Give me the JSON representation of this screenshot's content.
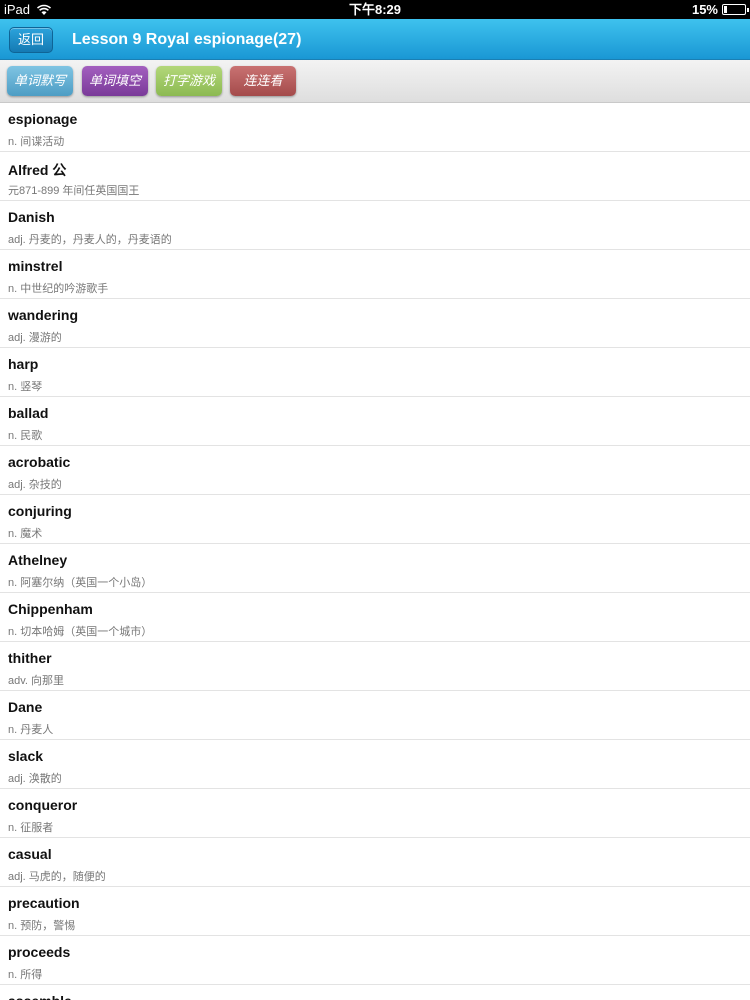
{
  "status": {
    "device": "iPad",
    "time": "下午8:29",
    "battery": "15%",
    "battery_level": 0.15
  },
  "header": {
    "back_label": "返回",
    "title": "Lesson 9 Royal espionage(27)"
  },
  "toolbar": {
    "buttons": [
      "单词默写",
      "单词填空",
      "打字游戏",
      "连连看"
    ]
  },
  "words": [
    {
      "word": "espionage",
      "meaning": "n. 间谍活动"
    },
    {
      "word": "Alfred 公",
      "meaning": "元871-899 年间任英国国王"
    },
    {
      "word": "Danish",
      "meaning": "adj. 丹麦的，丹麦人的，丹麦语的"
    },
    {
      "word": "minstrel",
      "meaning": "n. 中世纪的吟游歌手"
    },
    {
      "word": "wandering",
      "meaning": "adj. 漫游的"
    },
    {
      "word": "harp",
      "meaning": "n. 竖琴"
    },
    {
      "word": "ballad",
      "meaning": "n. 民歌"
    },
    {
      "word": "acrobatic",
      "meaning": "adj. 杂技的"
    },
    {
      "word": "conjuring",
      "meaning": "n. 魔术"
    },
    {
      "word": "Athelney",
      "meaning": "n. 阿塞尔纳（英国一个小岛）"
    },
    {
      "word": "Chippenham",
      "meaning": "n. 切本哈姆（英国一个城市）"
    },
    {
      "word": "thither",
      "meaning": "adv. 向那里"
    },
    {
      "word": "Dane",
      "meaning": "n. 丹麦人"
    },
    {
      "word": "slack",
      "meaning": "adj. 涣散的"
    },
    {
      "word": "conqueror",
      "meaning": "n. 征服者"
    },
    {
      "word": "casual",
      "meaning": "adj. 马虎的，随便的"
    },
    {
      "word": "precaution",
      "meaning": "n. 预防，警惕"
    },
    {
      "word": "proceeds",
      "meaning": "n. 所得"
    },
    {
      "word": "assemble",
      "meaning": ""
    }
  ]
}
